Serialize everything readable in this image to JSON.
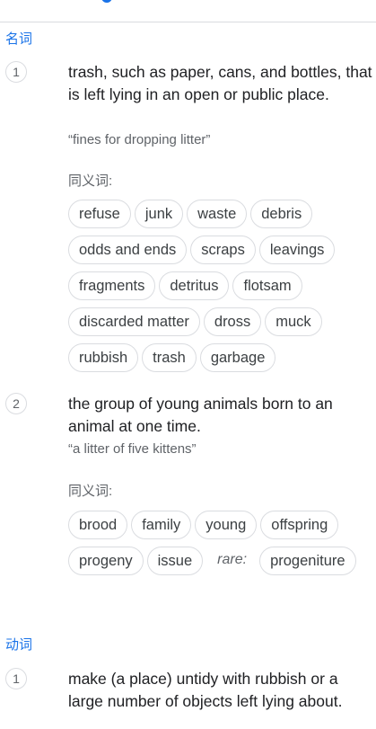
{
  "noun_label": "名词",
  "verb_label": "动词",
  "synonyms_label": "同义词:",
  "senses": [
    {
      "number": "1",
      "definition": "trash, such as paper, cans, and bottles, that is left lying in an open or public place.",
      "example": "“fines for dropping litter”",
      "synonyms": [
        "refuse",
        "junk",
        "waste",
        "debris",
        "odds and ends",
        "scraps",
        "leavings",
        "fragments",
        "detritus",
        "flotsam",
        "discarded matter",
        "dross",
        "muck",
        "rubbish",
        "trash",
        "garbage"
      ]
    },
    {
      "number": "2",
      "definition": "the group of young animals born to an animal at one time.",
      "example": "“a litter of five kittens”",
      "synonyms": [
        "brood",
        "family",
        "young",
        "offspring",
        "progeny",
        "issue"
      ],
      "rare_label": "rare:",
      "rare_synonyms": [
        "progeniture"
      ]
    }
  ],
  "verb_sense": {
    "number": "1",
    "definition": "make (a place) untidy with rubbish or a large number of objects left lying about."
  }
}
